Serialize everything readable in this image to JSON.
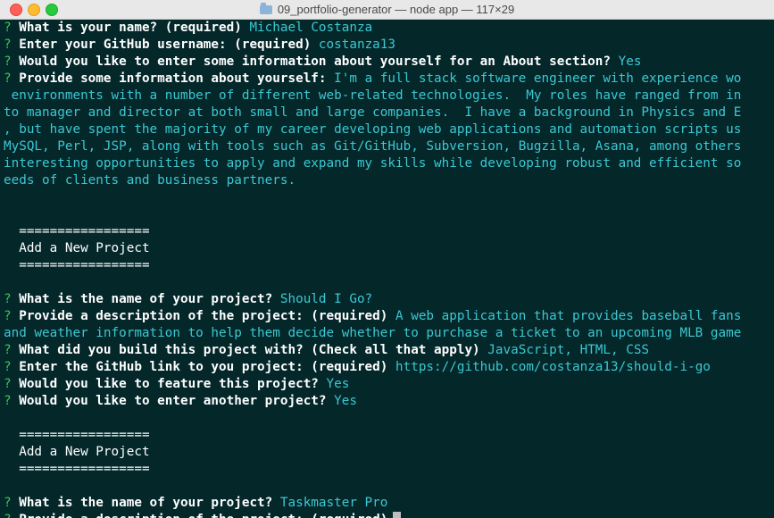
{
  "window": {
    "title": "09_portfolio-generator — node app — 117×29",
    "colors": {
      "background": "#04272a",
      "prompt_mark": "#37c65a",
      "answer": "#3cc8d2"
    }
  },
  "terminal": {
    "prompt_mark": "?",
    "q_name": "What is your name? (required)",
    "a_name": "Michael Costanza",
    "q_github": "Enter your GitHub username: (required)",
    "a_github": "costanza13",
    "q_about_confirm": "Would you like to enter some information about yourself for an About section?",
    "a_about_confirm": "Yes",
    "q_about": "Provide some information about yourself:",
    "a_about_l1": "I'm a full stack software engineer with experience wo",
    "a_about_l2": " environments with a number of different web-related technologies.  My roles have ranged from in",
    "a_about_l3": "to manager and director at both small and large companies.  I have a background in Physics and E",
    "a_about_l4": ", but have spent the majority of my career developing web applications and automation scripts us",
    "a_about_l5": "MySQL, Perl, JSP, along with tools such as Git/GitHub, Subversion, Bugzilla, Asana, among others",
    "a_about_l6": "interesting opportunities to apply and expand my skills while developing robust and efficient so",
    "a_about_l7": "eeds of clients and business partners.",
    "separator": "=================",
    "section_heading": "Add a New Project",
    "q_project_name": "What is the name of your project?",
    "a_project1_name": "Should I Go?",
    "q_project_desc": "Provide a description of the project: (required)",
    "a_project1_desc_l1": "A web application that provides baseball fans",
    "a_project1_desc_l2": "and weather information to help them decide whether to purchase a ticket to an upcoming MLB game",
    "q_languages": "What did you build this project with? (Check all that apply)",
    "a_languages": "JavaScript, HTML, CSS",
    "q_link": "Enter the GitHub link to you project: (required)",
    "a_link": "https://github.com/costanza13/should-i-go",
    "q_feature": "Would you like to feature this project?",
    "a_feature": "Yes",
    "q_another": "Would you like to enter another project?",
    "a_another": "Yes",
    "a_project2_name": "Taskmaster Pro"
  }
}
